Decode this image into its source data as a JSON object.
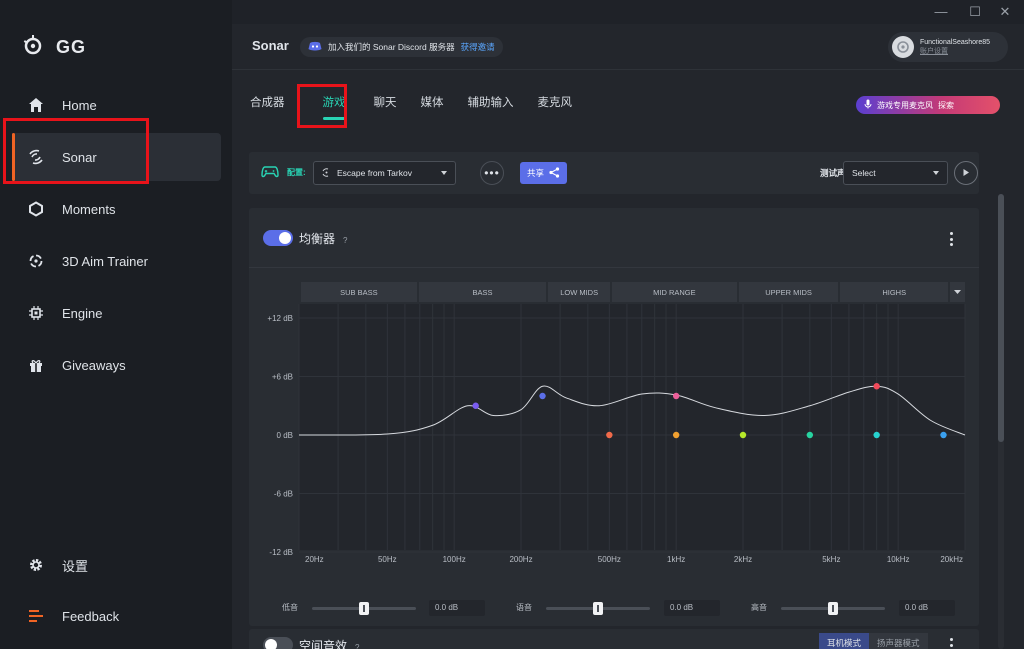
{
  "brand": {
    "name": "GG"
  },
  "sidebar": {
    "items": [
      {
        "label": "Home",
        "icon": "home-icon"
      },
      {
        "label": "Sonar",
        "icon": "sonar-icon",
        "active": true
      },
      {
        "label": "Moments",
        "icon": "hexagon-icon"
      },
      {
        "label": "3D Aim Trainer",
        "icon": "crosshair-icon"
      },
      {
        "label": "Engine",
        "icon": "chip-icon"
      },
      {
        "label": "Giveaways",
        "icon": "gift-icon"
      }
    ],
    "bottom": [
      {
        "label": "设置",
        "icon": "gear-icon"
      },
      {
        "label": "Feedback",
        "icon": "feedback-icon"
      }
    ]
  },
  "header": {
    "title": "Sonar",
    "discord_text": "加入我们的 Sonar Discord 服务器",
    "discord_link": "获得邀请",
    "user_name": "FunctionalSeashore85",
    "user_sub": "账户设置"
  },
  "tabs": [
    "合成器",
    "游戏",
    "聊天",
    "媒体",
    "辅助输入",
    "麦克风"
  ],
  "active_tab": "游戏",
  "promo": {
    "text": "游戏专用麦克风",
    "link": "探索"
  },
  "config": {
    "label": "配置:",
    "preset": "Escape from Tarkov",
    "more": "•••",
    "share": "共享",
    "test_label": "测试声音",
    "test_select": "Select"
  },
  "equalizer": {
    "title": "均衡器",
    "help": "?",
    "enabled": true,
    "bands": [
      "SUB BASS",
      "BASS",
      "LOW MIDS",
      "MID RANGE",
      "UPPER MIDS",
      "HIGHS"
    ],
    "y_labels": [
      "+12 dB",
      "+6 dB",
      "0 dB",
      "-6 dB",
      "-12 dB"
    ],
    "x_labels": [
      "20Hz",
      "50Hz",
      "100Hz",
      "200Hz",
      "500Hz",
      "1kHz",
      "2kHz",
      "5kHz",
      "10kHz",
      "20kHz"
    ],
    "points": [
      {
        "freq_hz": 125,
        "gain_db": 3.0,
        "color": "#7a5cf0"
      },
      {
        "freq_hz": 250,
        "gain_db": 4.0,
        "color": "#5b6ee8"
      },
      {
        "freq_hz": 500,
        "gain_db": 0,
        "color": "#f06a4a"
      },
      {
        "freq_hz": 1000,
        "gain_db": 0,
        "color": "#f0a030"
      },
      {
        "freq_hz": 1000,
        "gain_db": 4.0,
        "color": "#ec5f9a"
      },
      {
        "freq_hz": 2000,
        "gain_db": 0,
        "color": "#b6e82a"
      },
      {
        "freq_hz": 4000,
        "gain_db": 0,
        "color": "#27d3a0"
      },
      {
        "freq_hz": 8000,
        "gain_db": 5.0,
        "color": "#f04a5a"
      },
      {
        "freq_hz": 8000,
        "gain_db": 0,
        "color": "#27d3d0"
      },
      {
        "freq_hz": 16000,
        "gain_db": 0,
        "color": "#3aa0f0"
      }
    ],
    "curve": [
      [
        20,
        0
      ],
      [
        50,
        0.1
      ],
      [
        80,
        1.0
      ],
      [
        115,
        3.0
      ],
      [
        150,
        2.0
      ],
      [
        200,
        2.6
      ],
      [
        250,
        5.0
      ],
      [
        320,
        3.8
      ],
      [
        450,
        3.0
      ],
      [
        700,
        4.2
      ],
      [
        1000,
        4.1
      ],
      [
        1500,
        2.8
      ],
      [
        2500,
        2.0
      ],
      [
        4000,
        3.0
      ],
      [
        6000,
        4.4
      ],
      [
        8000,
        5.0
      ],
      [
        10000,
        4.2
      ],
      [
        14000,
        1.5
      ],
      [
        20000,
        0
      ]
    ],
    "ylim": [
      -12,
      12
    ],
    "xlim_hz": [
      20,
      20000
    ]
  },
  "mixers": [
    {
      "label": "低音",
      "value": "0.0 dB",
      "pos": 0.5
    },
    {
      "label": "语音",
      "value": "0.0 dB",
      "pos": 0.5
    },
    {
      "label": "高音",
      "value": "0.0 dB",
      "pos": 0.5
    }
  ],
  "spatial": {
    "title": "空间音效",
    "help": "?",
    "enabled": false,
    "modes": [
      "耳机模式",
      "扬声器模式"
    ]
  },
  "colors": {
    "accent": "#29d3b4",
    "primary": "#5b6ee8",
    "active_marker": "#f06424"
  }
}
